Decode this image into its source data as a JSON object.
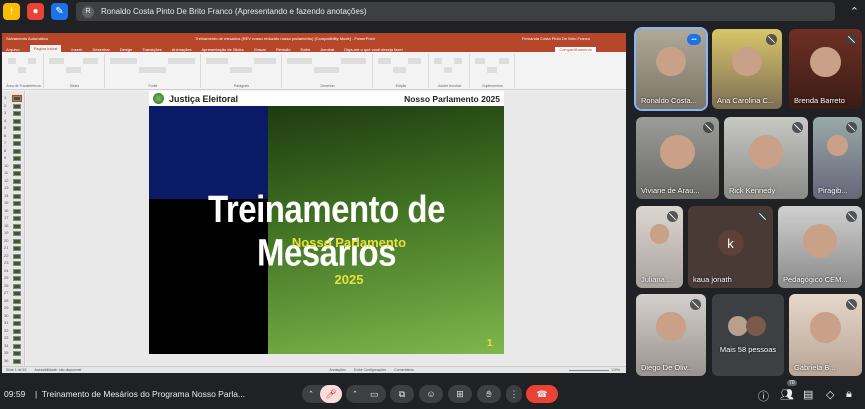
{
  "topbar": {
    "presenter_initial": "R",
    "presenter_text": "Ronaldo Costa Pinto De Brito Franco (Apresentando e fazendo anotações)",
    "expand_icon": "collapse-icon"
  },
  "powerpoint": {
    "title_left": "Salvamento Automático",
    "title_center": "Treinamento de mesarios (REV nosso reduzido nosso parlamento) [Compatibility Mode] - PowerPoint",
    "title_user": "Fernanda Costa Pinto De Brito Franco",
    "tabs": [
      "Arquivo",
      "Página Inicial",
      "Inserir",
      "Desenhar",
      "Design",
      "Transições",
      "Animações",
      "Apresentação de Slides",
      "Gravar",
      "Revisão",
      "Exibir",
      "Acrobat"
    ],
    "selected_tab": "Página Inicial",
    "tell_me": "Diga-me o que você deseja fazer",
    "share_label": "Compartilhamento",
    "ribbon_groups": [
      "Área de Transferência",
      "Slides",
      "Fonte",
      "Parágrafo",
      "Desenho",
      "Edição",
      "Adobe Acrobat",
      "Suplementos"
    ],
    "slide_numbers": [
      "1",
      "2",
      "3",
      "4",
      "5",
      "6",
      "7",
      "8",
      "9",
      "10",
      "11",
      "12",
      "13",
      "14",
      "15",
      "16",
      "17",
      "18",
      "19",
      "20",
      "21",
      "22",
      "23",
      "24",
      "25",
      "26",
      "27",
      "28",
      "29",
      "30",
      "31",
      "32",
      "33",
      "34",
      "35",
      "36"
    ],
    "status_left": "Slide 1 de 53",
    "status_access": "Acessibilidade: não disponível",
    "status_notes": "Anotações",
    "status_display": "Exibir Configurações",
    "status_comments": "Comentários",
    "zoom": "110%"
  },
  "slide": {
    "brand": "Justiça Eleitoral",
    "header_right": "Nosso Parlamento 2025",
    "title": "Treinamento de Mesários",
    "subtitle": "Nosso Parlamento",
    "year": "2025",
    "number": "1"
  },
  "participants": [
    {
      "name": "Ronaldo Costa...",
      "muted": false
    },
    {
      "name": "Ana Carolina C...",
      "muted": true
    },
    {
      "name": "Brenda Barreto",
      "muted": true
    },
    {
      "name": "Viviane de Arau...",
      "muted": true
    },
    {
      "name": "Rick Kennedy",
      "muted": true
    },
    {
      "name": "Piragib...",
      "muted": true
    },
    {
      "name": "Juliana ...",
      "muted": true
    },
    {
      "name": "kaua jonath",
      "muted": true,
      "initial": "k"
    },
    {
      "name": "Pedagógico CEM...",
      "muted": true
    },
    {
      "name": "Diego De Oliv...",
      "muted": true
    },
    {
      "name": "Mais 58 pessoas",
      "muted": false
    },
    {
      "name": "Gabriela B...",
      "muted": true
    }
  ],
  "bottom": {
    "time": "09:59",
    "separator": "|",
    "meeting": "Treinamento de Mesários do Programa Nosso Parla...",
    "people_count": "70"
  },
  "colors": {
    "accent": "#8ab4f8",
    "leave": "#ea4335",
    "ppt": "#b7472a"
  }
}
